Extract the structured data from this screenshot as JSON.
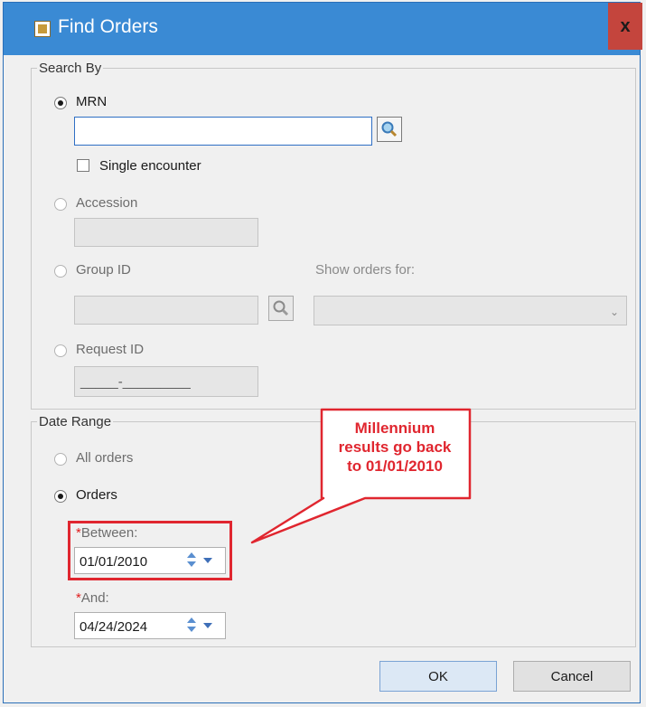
{
  "window": {
    "title": "Find Orders",
    "close_symbol": "x"
  },
  "search_by": {
    "legend": "Search By",
    "mrn": {
      "label": "MRN",
      "value": "",
      "selected": true
    },
    "single_encounter": {
      "label": "Single encounter",
      "checked": false
    },
    "accession": {
      "label": "Accession",
      "value": "",
      "selected": false
    },
    "group_id": {
      "label": "Group ID",
      "value": "",
      "selected": false
    },
    "show_orders_for": {
      "label": "Show orders for:",
      "value": ""
    },
    "request_id": {
      "label": "Request ID",
      "value": "_____-_________",
      "selected": false
    }
  },
  "date_range": {
    "legend": "Date Range",
    "all_orders": {
      "label": "All orders",
      "selected": false
    },
    "orders": {
      "label": "Orders",
      "selected": true
    },
    "between": {
      "required_mark": "*",
      "label": "Between:",
      "value": "01/01/2010"
    },
    "and": {
      "required_mark": "*",
      "label": "And:",
      "value": "04/24/2024"
    }
  },
  "annotation": {
    "callout_line1": "Millennium",
    "callout_line2": "results go back",
    "callout_line3": "to 01/01/2010",
    "color": "#e0262f"
  },
  "buttons": {
    "ok": "OK",
    "cancel": "Cancel"
  },
  "icons": {
    "search": "magnifier-icon",
    "spin": "spin-icon",
    "dropdown": "chevron-down-icon"
  }
}
